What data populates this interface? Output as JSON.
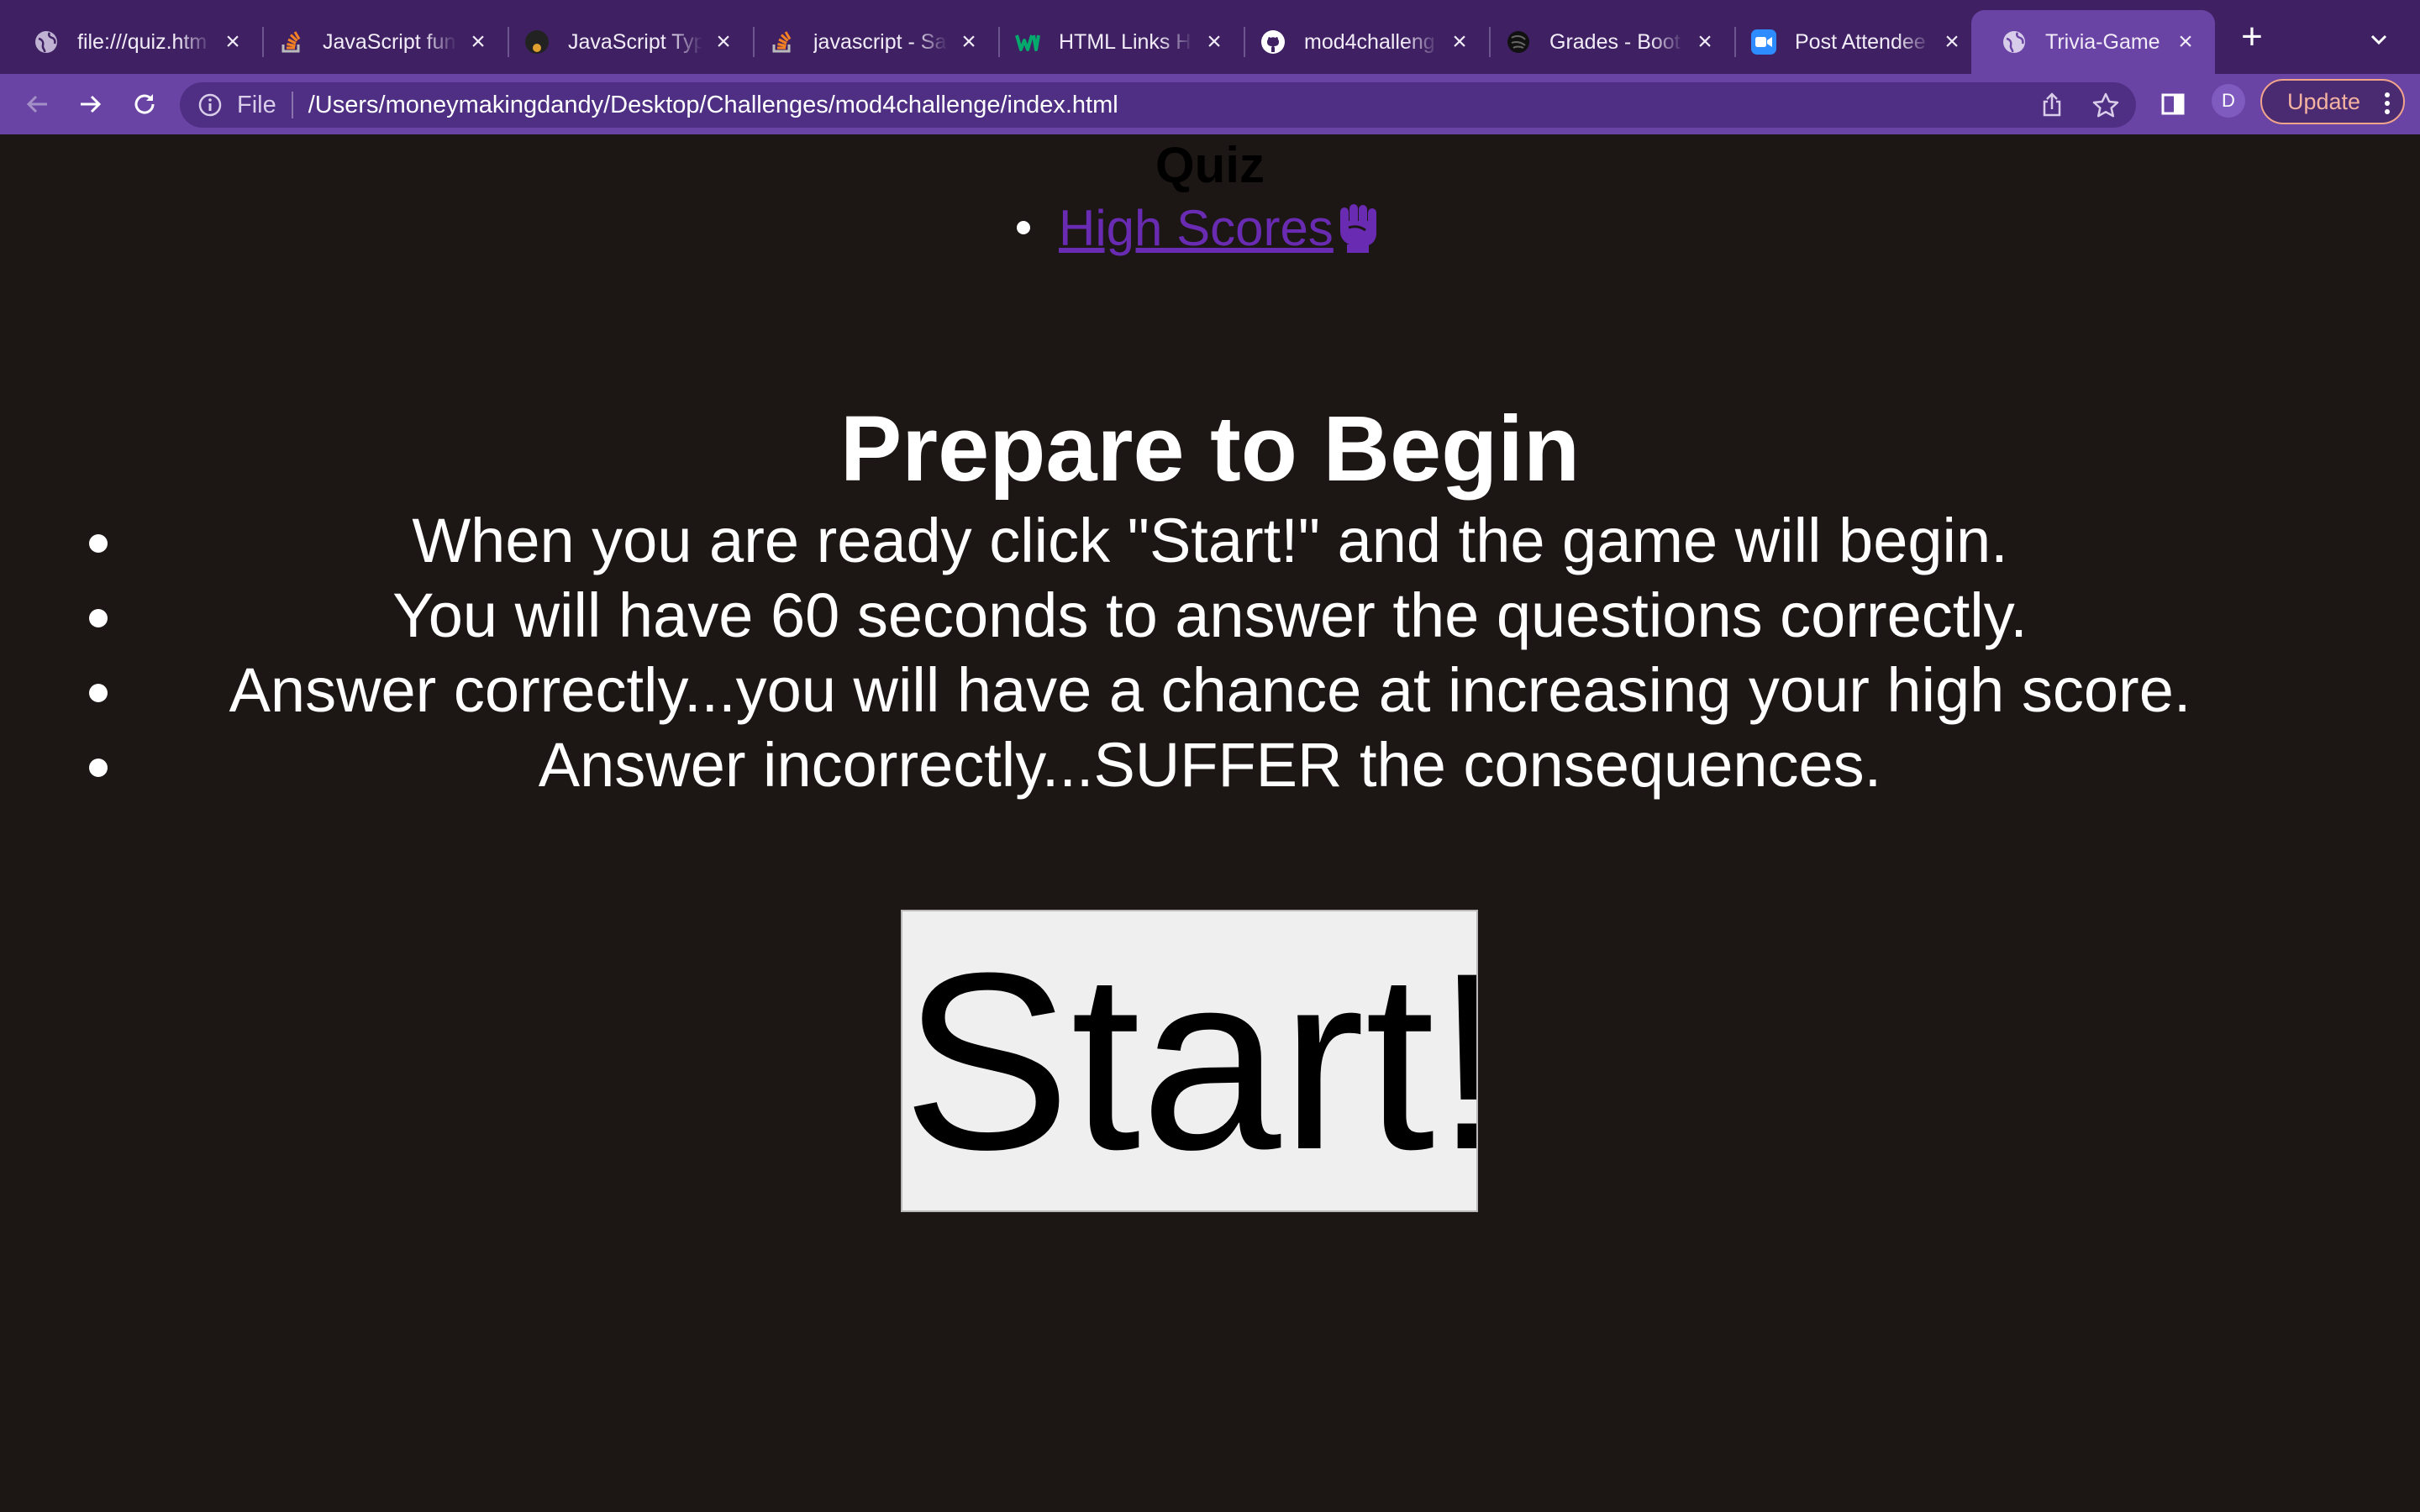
{
  "browser": {
    "tabs": [
      {
        "title": "file:///quiz.htm",
        "icon": "globe-icon"
      },
      {
        "title": "JavaScript fun",
        "icon": "stack-overflow-icon"
      },
      {
        "title": "JavaScript Typ",
        "icon": "avatar-icon"
      },
      {
        "title": "javascript - Sa",
        "icon": "stack-overflow-icon"
      },
      {
        "title": "HTML Links H",
        "icon": "w3schools-icon"
      },
      {
        "title": "mod4challeng",
        "icon": "github-icon"
      },
      {
        "title": "Grades - Boot",
        "icon": "bootcamp-icon"
      },
      {
        "title": "Post Attendee",
        "icon": "zoom-icon"
      },
      {
        "title": "Trivia-Game",
        "icon": "globe-icon"
      }
    ],
    "new_tab_label": "+",
    "address": {
      "scheme_label": "File",
      "url": "/Users/moneymakingdandy/Desktop/Challenges/mod4challenge/index.html"
    },
    "profile_initial": "D",
    "update_label": "Update",
    "colors": {
      "tabstrip": "#3f2163",
      "toolbar": "#6a44a4",
      "omnibox": "#4f2f83"
    }
  },
  "page": {
    "title": "Quiz",
    "nav": {
      "high_scores_label": "High Scores",
      "high_scores_icon": "raised-fist-icon"
    },
    "heading": "Prepare to Begin",
    "instructions": [
      "When you are ready click \"Start!\" and the game will begin.",
      "You will have 60 seconds to answer the questions correctly.",
      "Answer correctly...you will have a chance at increasing your high score.",
      "Answer incorrectly...SUFFER the consequences."
    ],
    "start_label": "Start!",
    "colors": {
      "background": "#1c1614",
      "link": "#6a2bb3",
      "button": "#efefef"
    }
  }
}
